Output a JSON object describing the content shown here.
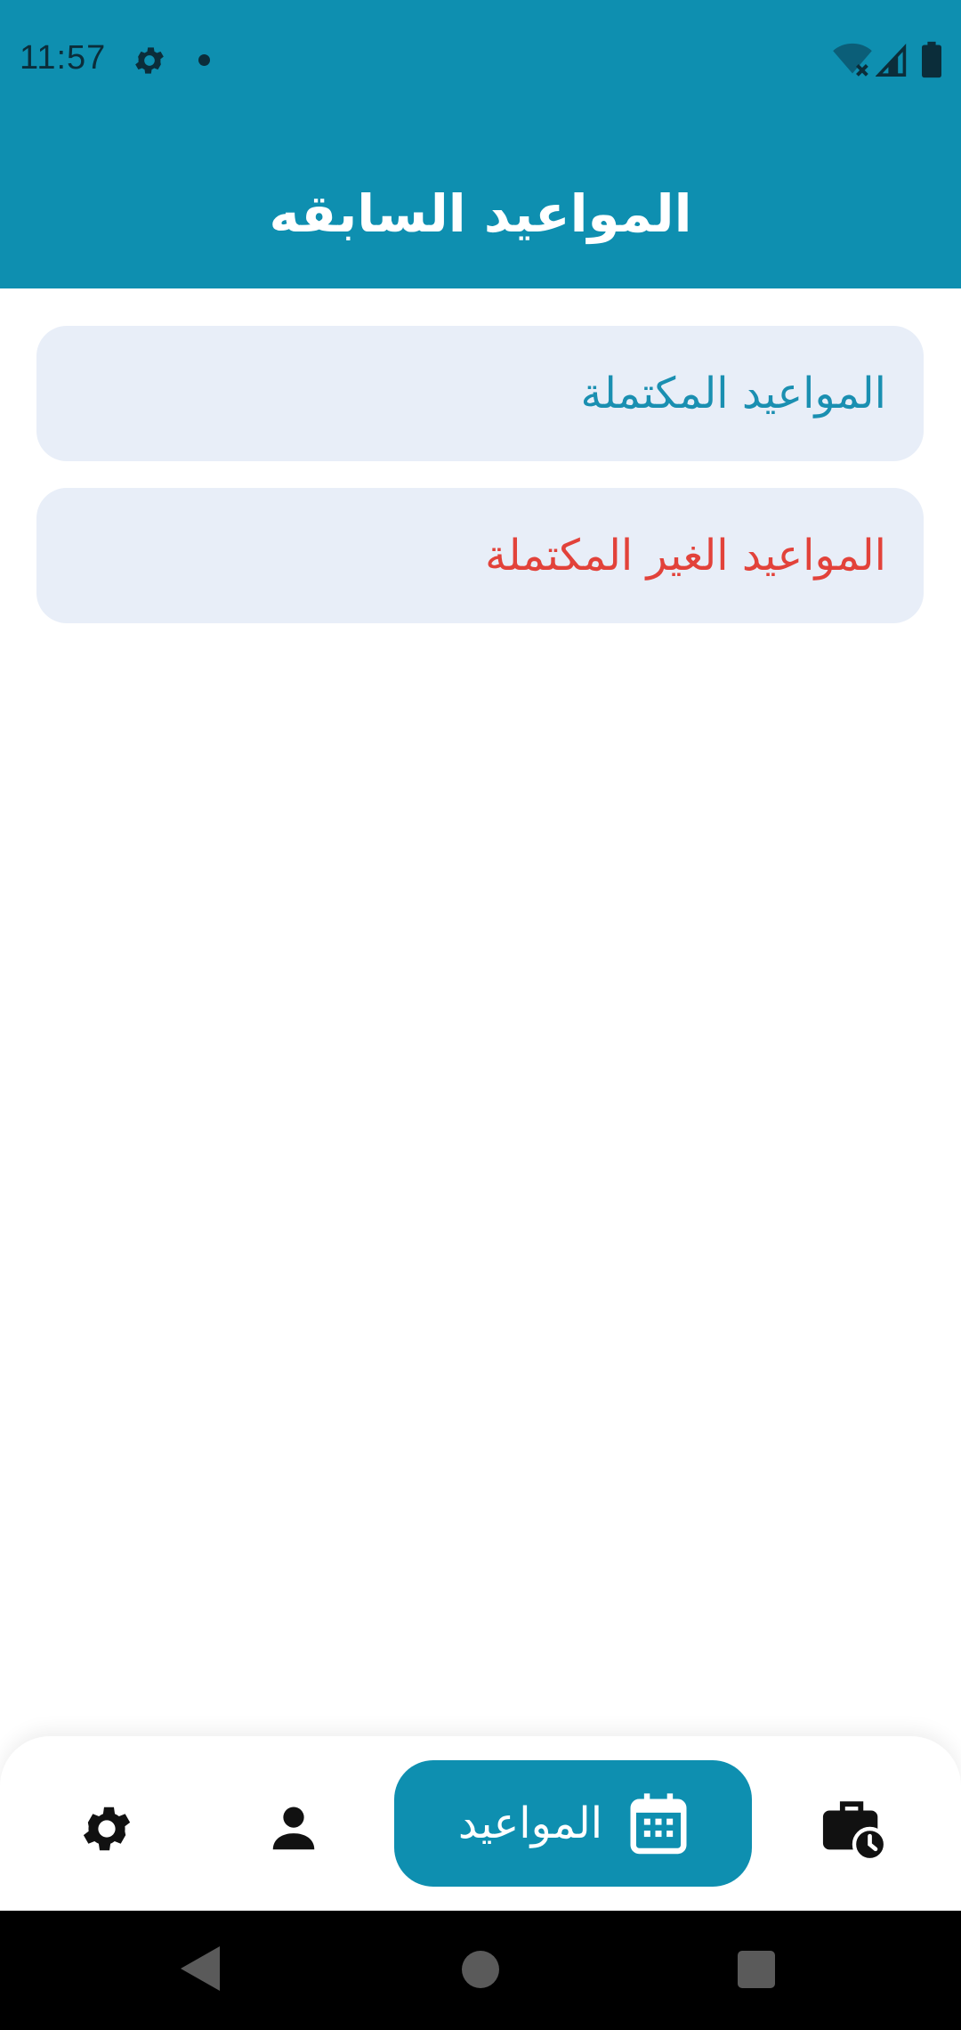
{
  "status_bar": {
    "time": "11:57",
    "icons": [
      "gear-icon",
      "notification-dot-icon",
      "wifi-off-icon",
      "signal-icon",
      "battery-icon"
    ]
  },
  "header": {
    "title": "المواعيد السابقه"
  },
  "list": {
    "items": [
      {
        "label": "المواعيد المكتملة",
        "color": "#1a8fb1"
      },
      {
        "label": "المواعيد الغير المكتملة",
        "color": "#e2423a"
      }
    ]
  },
  "bottom_nav": {
    "items": [
      {
        "icon": "history-briefcase-icon"
      },
      {
        "label": "المواعيد",
        "icon": "calendar-icon",
        "selected": true
      },
      {
        "icon": "person-icon"
      },
      {
        "icon": "settings-icon"
      }
    ]
  },
  "colors": {
    "primary": "#0e8fb0",
    "card_background": "#e8eef8",
    "completed_text": "#1a8fb1",
    "incomplete_text": "#e2423a"
  },
  "system_nav": {
    "icons": [
      "back-icon",
      "home-icon",
      "recents-icon"
    ]
  }
}
